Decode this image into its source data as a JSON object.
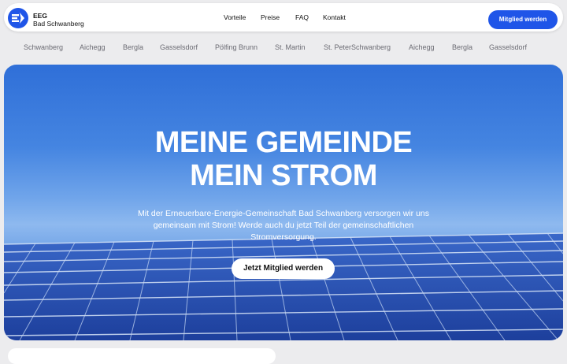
{
  "header": {
    "brand_line1": "EEG",
    "brand_line2": "Bad Schwanberg",
    "logo_icon": "lightning-plug-icon",
    "nav": [
      "Vorteile",
      "Preise",
      "FAQ",
      "Kontakt"
    ],
    "cta_label": "Mitglied werden",
    "accent": "#1f55e8"
  },
  "ticker": {
    "items": [
      "Schwanberg",
      "Aichegg",
      "Bergla",
      "Gasselsdorf",
      "Pölfing Brunn",
      "St. Martin",
      "St. PeterSchwanberg",
      "Aichegg",
      "Bergla",
      "Gasselsdorf"
    ]
  },
  "hero": {
    "title_line1": "MEINE GEMEINDE",
    "title_line2": "MEIN STROM",
    "text": "Mit der Erneuerbare-Energie-Gemeinschaft Bad Schwanberg versorgen wir uns gemeinsam mit Strom! Werde auch du jetzt Teil der gemeinschaftlichen Stromversorgung.",
    "cta_label": "Jetzt Mitglied werden",
    "background_image": "solar-panels-blue-sky"
  }
}
